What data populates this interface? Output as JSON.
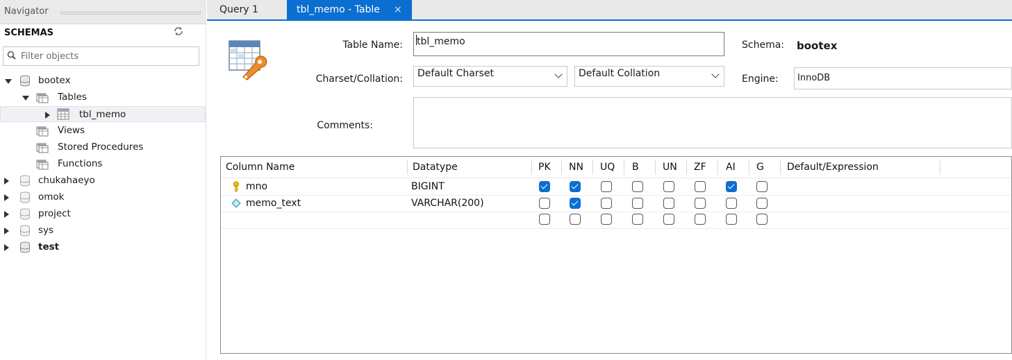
{
  "navigator": {
    "title": "Navigator",
    "schemas_label": "SCHEMAS",
    "filter_placeholder": "Filter objects",
    "tree": {
      "bootex": "bootex",
      "tables": "Tables",
      "tbl_memo": "tbl_memo",
      "views": "Views",
      "stored_procedures": "Stored Procedures",
      "functions": "Functions",
      "chukahaeyo": "chukahaeyo",
      "omok": "omok",
      "project": "project",
      "sys": "sys",
      "test": "test"
    }
  },
  "tabs": {
    "query": "Query 1",
    "active": "tbl_memo - Table",
    "close": "×"
  },
  "editor": {
    "table_name_label": "Table Name:",
    "table_name_value": "tbl_memo",
    "schema_label": "Schema:",
    "schema_value": "bootex",
    "charset_label": "Charset/Collation:",
    "charset_value": "Default Charset",
    "collation_value": "Default Collation",
    "engine_label": "Engine:",
    "engine_value": "InnoDB",
    "comments_label": "Comments:"
  },
  "grid": {
    "headers": {
      "column_name": "Column Name",
      "datatype": "Datatype",
      "pk": "PK",
      "nn": "NN",
      "uq": "UQ",
      "b": "B",
      "un": "UN",
      "zf": "ZF",
      "ai": "AI",
      "g": "G",
      "default": "Default/Expression"
    },
    "rows": [
      {
        "name": "mno",
        "type": "BIGINT",
        "icon": "primary-key-icon"
      },
      {
        "name": "memo_text",
        "type": "VARCHAR(200)",
        "icon": "column-diamond-icon"
      }
    ],
    "flags": [
      {
        "pk": true,
        "nn": true,
        "uq": false,
        "b": false,
        "un": false,
        "zf": false,
        "ai": true,
        "g": false
      },
      {
        "pk": false,
        "nn": true,
        "uq": false,
        "b": false,
        "un": false,
        "zf": false,
        "ai": false,
        "g": false
      },
      {
        "pk": false,
        "nn": false,
        "uq": false,
        "b": false,
        "un": false,
        "zf": false,
        "ai": false,
        "g": false
      }
    ]
  },
  "colors": {
    "accent": "#0b6ed1"
  }
}
